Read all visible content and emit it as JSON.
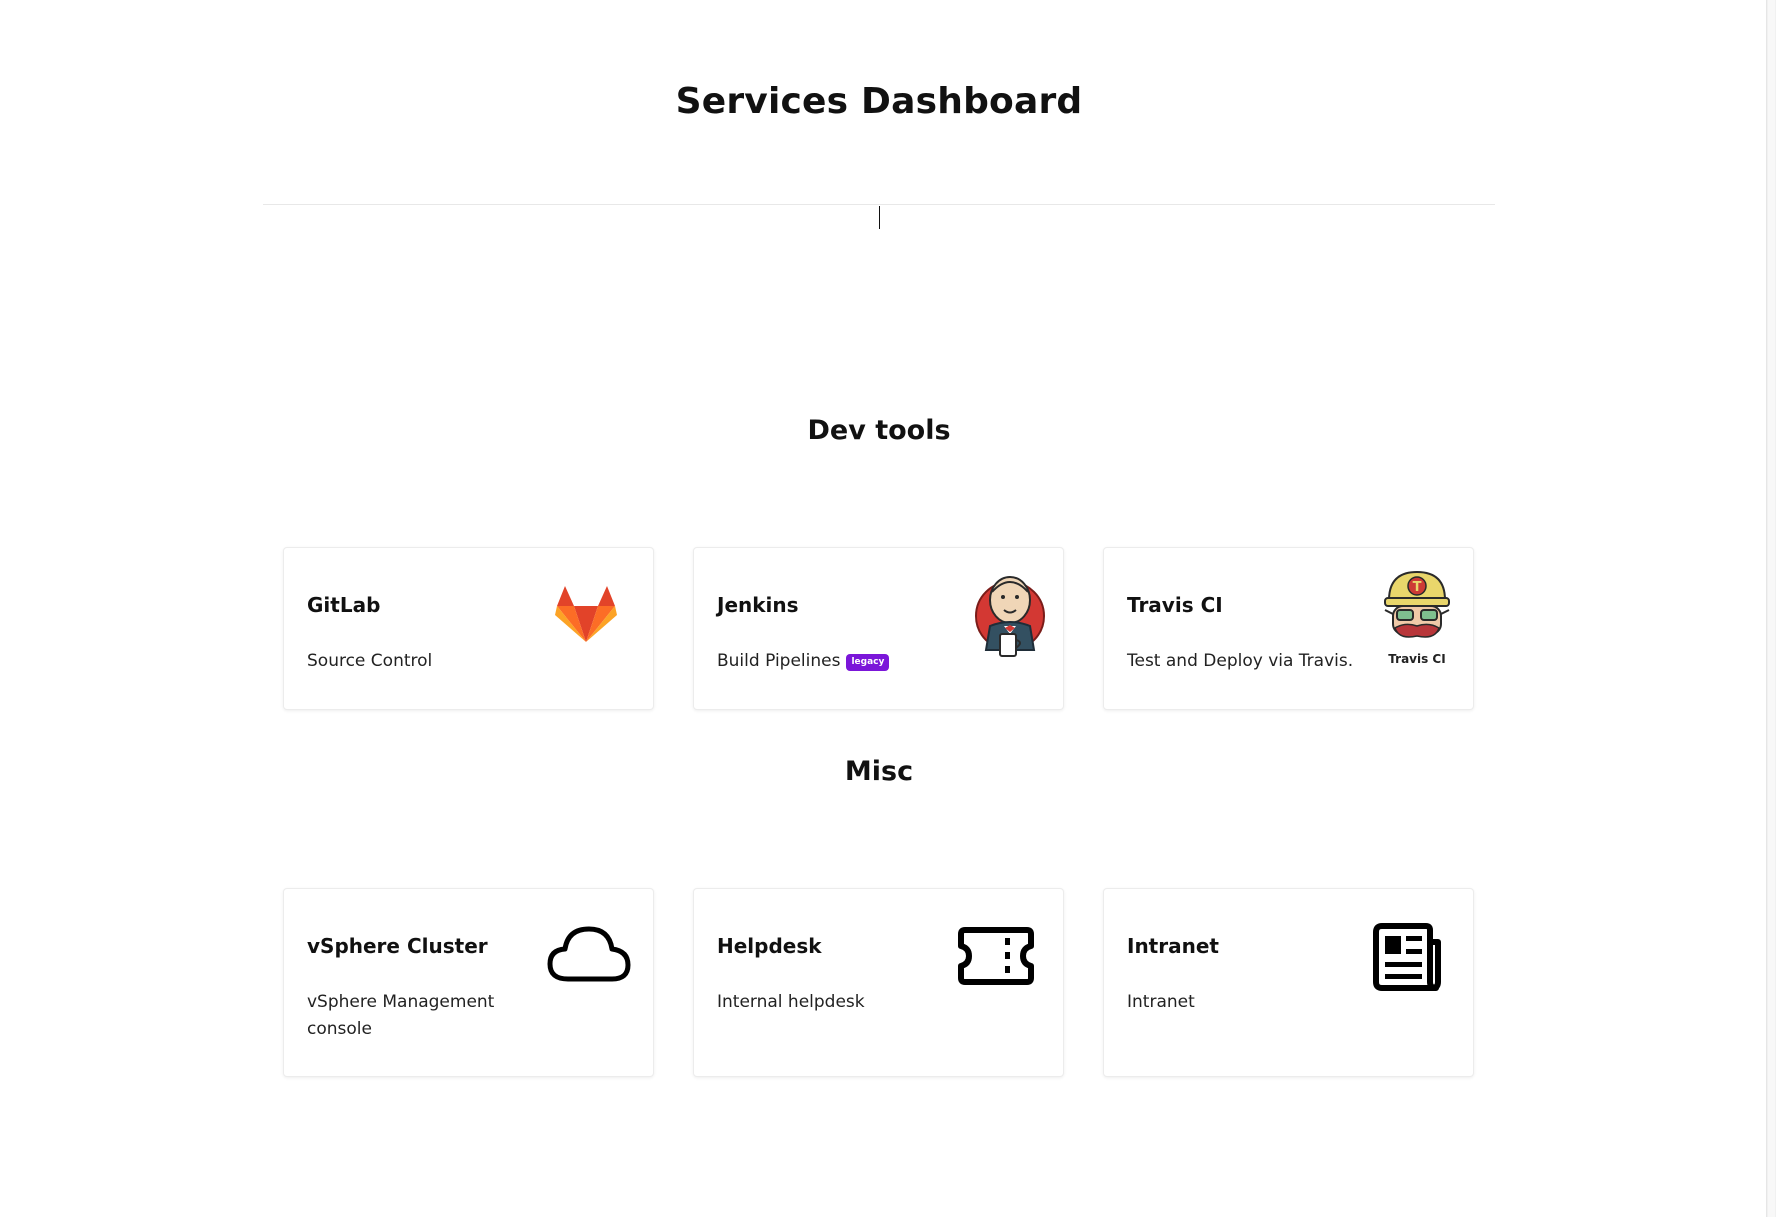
{
  "header": {
    "title": "Services Dashboard"
  },
  "search": {
    "value": "",
    "placeholder": ""
  },
  "sections": [
    {
      "title": "Dev tools",
      "services": [
        {
          "name": "GitLab",
          "description": "Source Control",
          "icon": "gitlab-logo-icon"
        },
        {
          "name": "Jenkins",
          "description": "Build Pipelines",
          "badge": "legacy",
          "icon": "jenkins-logo-icon"
        },
        {
          "name": "Travis CI",
          "description": "Test and Deploy via Travis.",
          "icon": "travis-ci-logo-icon",
          "logo_text": "Travis CI"
        }
      ]
    },
    {
      "title": "Misc",
      "services": [
        {
          "name": "vSphere Cluster",
          "description": "vSphere Management console",
          "icon": "cloud-icon"
        },
        {
          "name": "Helpdesk",
          "description": "Internal helpdesk",
          "icon": "ticket-icon"
        },
        {
          "name": "Intranet",
          "description": "Intranet",
          "icon": "newspaper-icon"
        }
      ]
    }
  ],
  "colors": {
    "badge": "#7b16d9",
    "gitlab_orange": "#fc6d26",
    "gitlab_red": "#e24329",
    "gitlab_yellow": "#fca326",
    "jenkins_red": "#d33833",
    "text": "#111111",
    "card_border": "#ececec"
  }
}
